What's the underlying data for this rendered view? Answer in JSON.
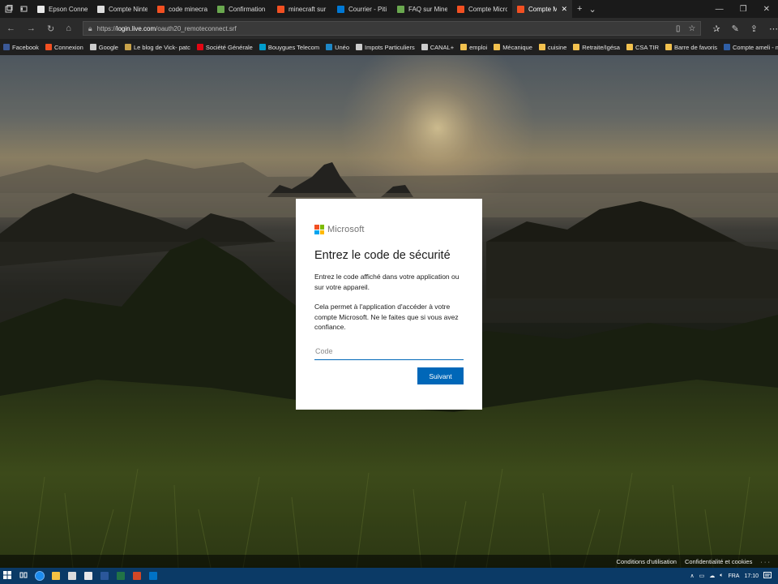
{
  "browser": {
    "tabs": [
      {
        "label": "Epson Connect - Print a",
        "favicon_color": "#e8e8e8",
        "active": false
      },
      {
        "label": "Compte Nintendo",
        "favicon_color": "#dddddd",
        "active": false
      },
      {
        "label": "code minecraft - Micros",
        "favicon_color": "#f25022",
        "active": false
      },
      {
        "label": "Confirmation Minecraft",
        "favicon_color": "#6aa84f",
        "active": false
      },
      {
        "label": "minecraft sur switch et",
        "favicon_color": "#f25022",
        "active": false
      },
      {
        "label": "Courrier - Piti LSN - Out",
        "favicon_color": "#0078d4",
        "active": false
      },
      {
        "label": "FAQ sur Minecraft pour",
        "favicon_color": "#6aa84f",
        "active": false
      },
      {
        "label": "Compte Microsoft",
        "favicon_color": "#f25022",
        "active": false
      },
      {
        "label": "Compte Microsoft",
        "favicon_color": "#f25022",
        "active": true
      }
    ],
    "url": {
      "prefix": "https://",
      "host": "login.live.com",
      "path": "/oauth20_remoteconnect.srf"
    },
    "favorites": [
      {
        "label": "Facebook",
        "color": "#3b5998"
      },
      {
        "label": "Connexion",
        "color": "#f25022"
      },
      {
        "label": "Google",
        "color": "#cccccc"
      },
      {
        "label": "Le blog de Vick- patc",
        "color": "#c8a24a"
      },
      {
        "label": "Société Générale",
        "color": "#e30613"
      },
      {
        "label": "Bouygues Telecom",
        "color": "#009dcc"
      },
      {
        "label": "Unéo",
        "color": "#1e88c7"
      },
      {
        "label": "Impots Particuliers",
        "color": "#cccccc"
      },
      {
        "label": "CANAL+",
        "color": "#cccccc"
      },
      {
        "label": "emploi",
        "color": "#f2c14e"
      },
      {
        "label": "Mécanique",
        "color": "#f2c14e"
      },
      {
        "label": "cuisine",
        "color": "#f2c14e"
      },
      {
        "label": "Retraite/Igésa",
        "color": "#f2c14e"
      },
      {
        "label": "CSA TIR",
        "color": "#f2c14e"
      },
      {
        "label": "Barre de favoris",
        "color": "#f2c14e"
      },
      {
        "label": "Compte ameli - mon",
        "color": "#2f5fa7"
      }
    ]
  },
  "card": {
    "brand": "Microsoft",
    "title": "Entrez le code de sécurité",
    "paragraph1": "Entrez le code affiché dans votre application ou sur votre appareil.",
    "paragraph2": "Cela permet à l'application d'accéder à votre compte Microsoft. Ne le faites que si vous avez confiance.",
    "code_placeholder": "Code",
    "code_value": "",
    "next_button": "Suivant",
    "logo_colors": [
      "#f25022",
      "#7fba00",
      "#00a4ef",
      "#ffb900"
    ]
  },
  "footer": {
    "terms": "Conditions d'utilisation",
    "privacy": "Confidentialité et cookies",
    "more": "· · ·"
  },
  "taskbar": {
    "language": "FRA",
    "time": "17:10"
  }
}
